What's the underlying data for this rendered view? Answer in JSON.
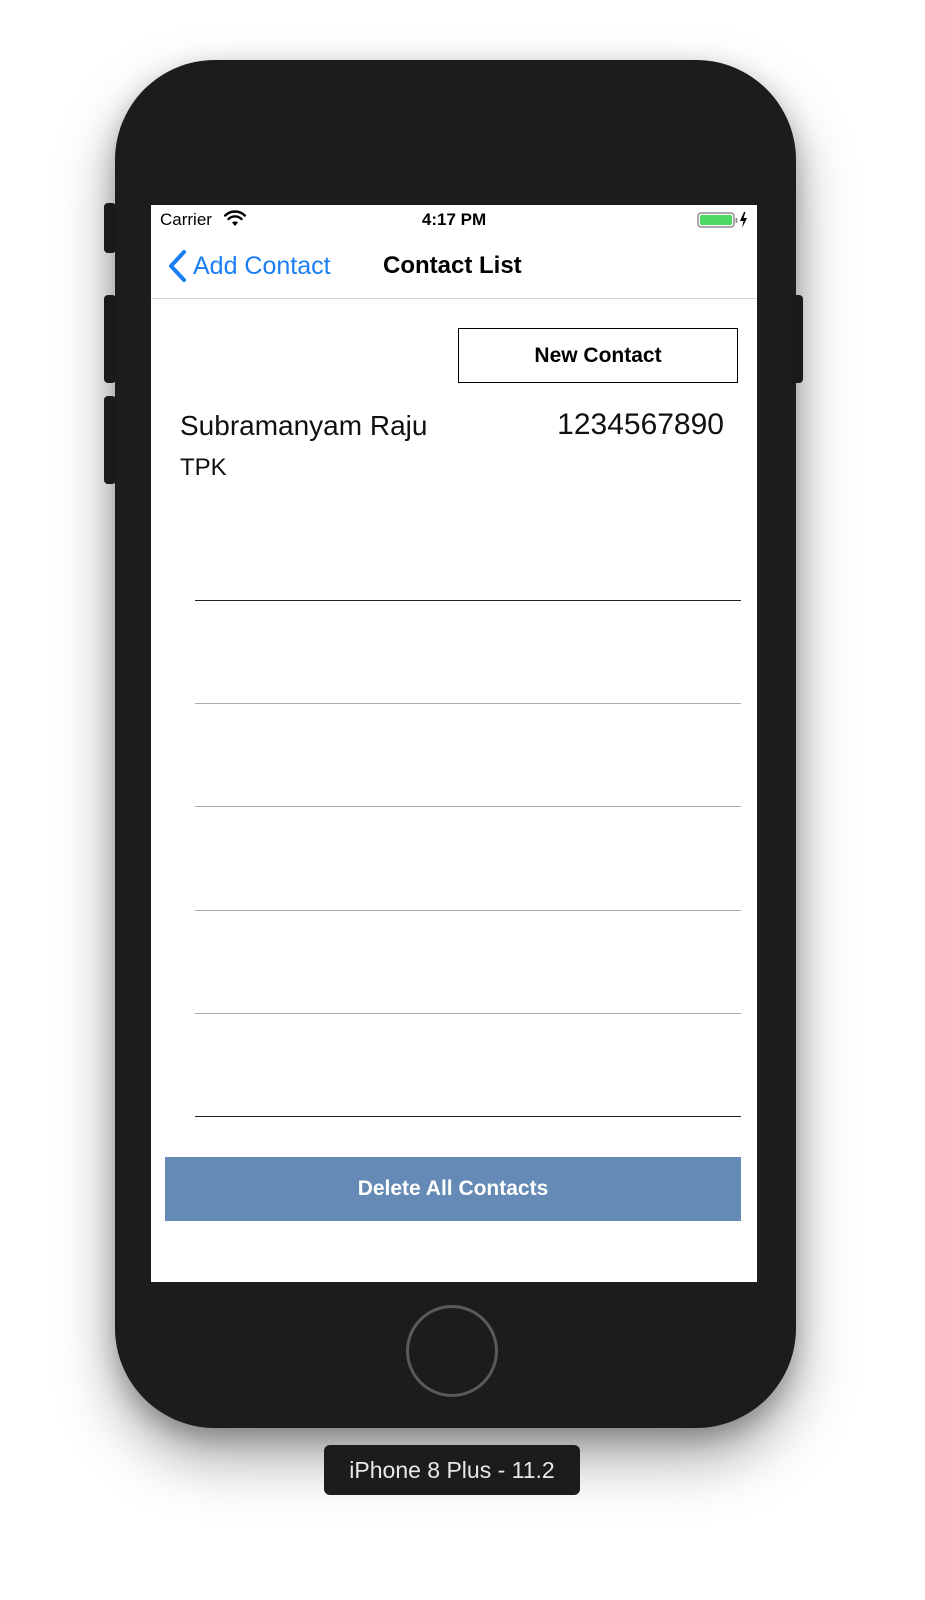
{
  "status_bar": {
    "carrier": "Carrier",
    "time": "4:17 PM",
    "wifi_icon": "wifi-icon",
    "battery_icon": "battery-charging-icon",
    "battery_color": "#4cd964"
  },
  "nav_bar": {
    "back_label": "Add Contact",
    "back_icon": "chevron-left-icon",
    "title": "Contact List",
    "accent_color": "#1b7ef5"
  },
  "new_contact_button": {
    "label": "New Contact"
  },
  "contacts": [
    {
      "name": "Subramanyam Raju",
      "phone": "1234567890",
      "location": "TPK"
    }
  ],
  "delete_button": {
    "label": "Delete All Contacts",
    "color": "#648ab5"
  },
  "device": {
    "label": "iPhone 8 Plus - 11.2"
  }
}
